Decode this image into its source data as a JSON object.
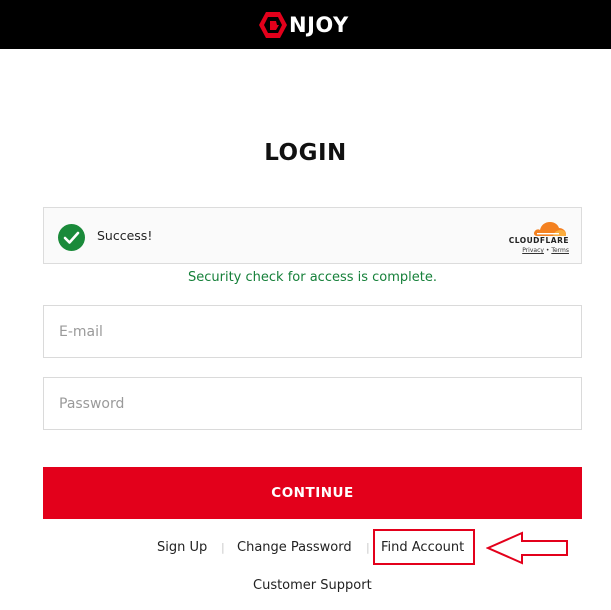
{
  "header": {
    "brand_name": "NJOY",
    "brand_icon": "njoy-logo-icon",
    "background_color": "#000000",
    "brand_color": "#e3001b"
  },
  "login": {
    "title": "LOGIN"
  },
  "captcha": {
    "status": "Success!",
    "status_icon": "check-circle-icon",
    "check_color": "#1a8a3a",
    "provider": "CLOUDFLARE",
    "provider_icon": "cloudflare-cloud-icon",
    "privacy_label": "Privacy",
    "separator": "•",
    "terms_label": "Terms",
    "message": "Security check for access is complete.",
    "message_color": "#16803a"
  },
  "form": {
    "email_placeholder": "E-mail",
    "email_value": "",
    "password_placeholder": "Password",
    "password_value": "",
    "continue_label": "CONTINUE",
    "button_color": "#e3001b"
  },
  "links": {
    "sign_up": "Sign Up",
    "separator": "|",
    "change_password": "Change Password",
    "find_account": "Find Account",
    "customer_support": "Customer Support"
  },
  "annotation": {
    "highlight_color": "#e3001b",
    "arrow_icon": "left-arrow-icon"
  }
}
